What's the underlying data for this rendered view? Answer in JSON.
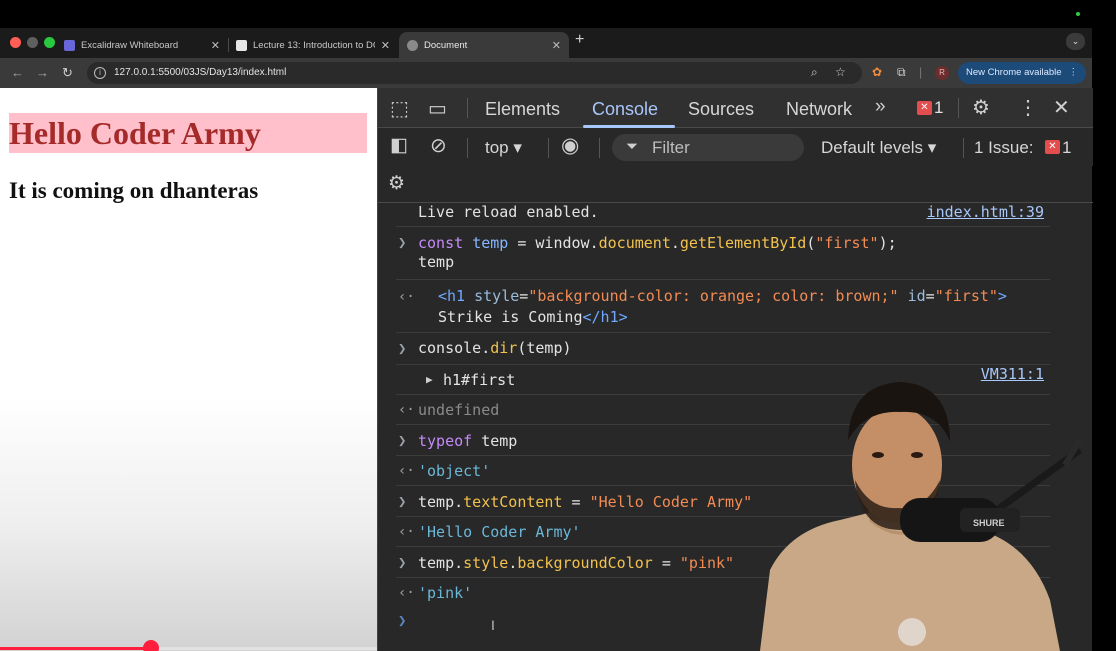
{
  "browser": {
    "tabs": [
      {
        "title": "Excalidraw Whiteboard",
        "active": false
      },
      {
        "title": "Lecture 13: Introduction to DO",
        "active": false
      },
      {
        "title": "Document",
        "active": true
      }
    ],
    "url": "127.0.0.1:5500/03JS/Day13/index.html",
    "profile_initial": "R",
    "new_chrome_label": "New Chrome available"
  },
  "page": {
    "h1": "Hello Coder Army",
    "h2": "It is coming on dhanteras",
    "h1_background": "#ffc0cb",
    "h1_color": "#a52a2a"
  },
  "devtools": {
    "tabs": [
      "Elements",
      "Console",
      "Sources",
      "Network"
    ],
    "active_tab": "Console",
    "error_count": "1",
    "context": "top",
    "filter_placeholder": "Filter",
    "levels": "Default levels",
    "issues_label": "1 Issue:",
    "issues_count": "1",
    "console": {
      "live_reload": "Live reload enabled.",
      "live_reload_source": "index.html:39",
      "cmd1_line2": "temp",
      "result1_line2": "Strike is Coming",
      "dir_result": "h1#first",
      "dir_source": "VM311:1",
      "undefined": "undefined",
      "typeof_result": "'object'",
      "text_result": "'Hello Coder Army'",
      "bg_result": "'pink'"
    }
  },
  "colors": {
    "accent": "#a8c7fa",
    "error": "#e34d4d",
    "video_progress": "#ff1f3d"
  },
  "video_progress_fraction": 0.4
}
